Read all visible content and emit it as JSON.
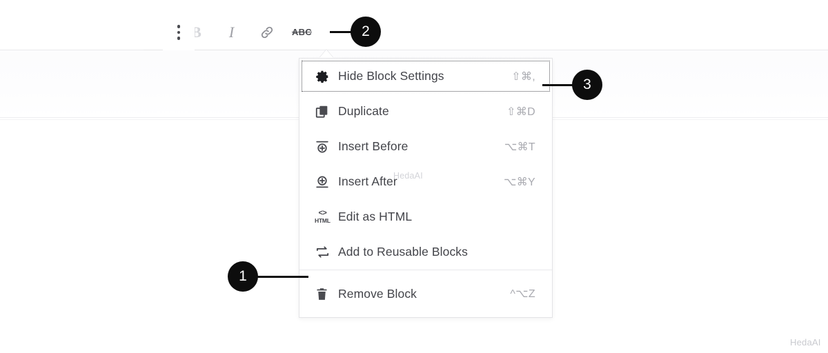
{
  "toolbar": {
    "name": "block-format-toolbar",
    "buttons": [
      {
        "id": "hidden-left",
        "label": "",
        "icon": "block-type-icon"
      },
      {
        "id": "bold",
        "label": "B",
        "icon": "bold-icon"
      },
      {
        "id": "italic",
        "label": "I",
        "icon": "italic-icon"
      },
      {
        "id": "link",
        "label": "🔗",
        "icon": "link-icon"
      },
      {
        "id": "strikethrough",
        "label": "ABC",
        "icon": "strikethrough-icon"
      }
    ],
    "more_options_label": "More options"
  },
  "menu": {
    "name": "block-options-dropdown",
    "items": [
      {
        "label": "Hide Block Settings",
        "shortcut": "⇧⌘,",
        "icon": "gear-icon",
        "focused": true
      },
      {
        "label": "Duplicate",
        "shortcut": "⇧⌘D",
        "icon": "duplicate-icon",
        "focused": false
      },
      {
        "label": "Insert Before",
        "shortcut": "⌥⌘T",
        "icon": "insert-before-icon",
        "focused": false
      },
      {
        "label": "Insert After",
        "shortcut": "⌥⌘Y",
        "icon": "insert-after-icon",
        "focused": false
      },
      {
        "label": "Edit as HTML",
        "shortcut": "",
        "icon": "html-icon",
        "focused": false
      },
      {
        "label": "Add to Reusable Blocks",
        "shortcut": "",
        "icon": "reusable-blocks-icon",
        "focused": false
      },
      {
        "label": "Remove Block",
        "shortcut": "^⌥Z",
        "icon": "trash-icon",
        "focused": false
      }
    ],
    "html_icon_chevrons": "<>",
    "html_icon_text": "HTML"
  },
  "callouts": [
    {
      "number": "1",
      "target": "block-options-dropdown"
    },
    {
      "number": "2",
      "target": "more-options-button"
    },
    {
      "number": "3",
      "target": "hide-block-settings-item"
    }
  ],
  "watermarks": {
    "center": "HedaAI",
    "corner": "HedaAI"
  },
  "colors": {
    "badge_background": "#0d0d0d",
    "badge_text": "#ffffff",
    "menu_background": "#ffffff",
    "menu_border": "#e3e3e6",
    "label_text": "#43444a",
    "shortcut_text": "#a9aab0"
  }
}
